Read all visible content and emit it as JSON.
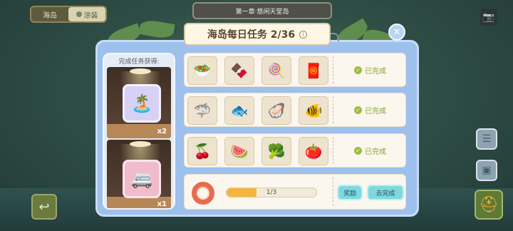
{
  "topbar": {
    "tabs": [
      {
        "label": "海岛",
        "active": false
      },
      {
        "label": "涂装",
        "active": true,
        "icon": "pin-icon"
      }
    ],
    "chapter_title": "第一章·悠闲天堂岛",
    "camera_icon": "camera-icon"
  },
  "panel": {
    "title": "海岛每日任务 2/36",
    "info_icon": "info-icon",
    "close_icon": "close-icon",
    "rewards": {
      "header": "完成任务获得:",
      "items": [
        {
          "name": "island-decoration-card",
          "icon": "🏝️",
          "qty": "x2"
        },
        {
          "name": "food-truck-card",
          "icon": "🚐",
          "qty": "x1"
        }
      ]
    },
    "tasks": [
      {
        "items": [
          "🥗",
          "🍫",
          "🍭",
          "🧧"
        ],
        "status": "已完成"
      },
      {
        "items": [
          "🦈",
          "🐟",
          "🦪",
          "🐠"
        ],
        "status": "已完成"
      },
      {
        "items": [
          "🍒",
          "🍉",
          "🥦",
          "🍅"
        ],
        "status": "已完成"
      }
    ],
    "progress": {
      "icon": "life-ring-icon",
      "text": "1/3",
      "fraction": 0.333,
      "reward_button": "奖励",
      "go_button": "去完成"
    }
  },
  "colors": {
    "panel_blue": "#9ec0ec",
    "done_green": "#8aa13c",
    "progress_fill": "#f2b640",
    "button_cyan": "#7ed9df"
  }
}
